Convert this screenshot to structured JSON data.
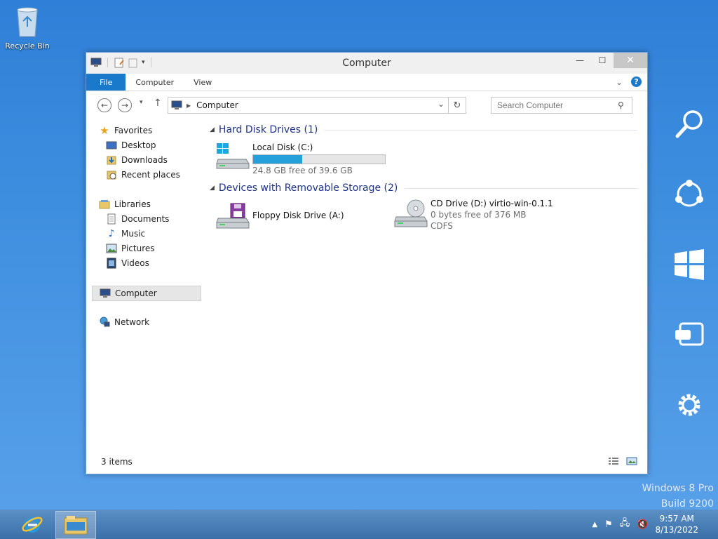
{
  "desktop": {
    "recycle_bin_label": "Recycle Bin"
  },
  "window": {
    "title": "Computer",
    "ribbon": {
      "tabs": [
        "File",
        "Computer",
        "View"
      ]
    },
    "address": {
      "path": "Computer"
    },
    "search": {
      "placeholder": "Search Computer"
    },
    "sidebar": {
      "favorites": "Favorites",
      "favorite_items": [
        "Desktop",
        "Downloads",
        "Recent places"
      ],
      "libraries": "Libraries",
      "library_items": [
        "Documents",
        "Music",
        "Pictures",
        "Videos"
      ],
      "computer": "Computer",
      "network": "Network"
    },
    "groups": [
      {
        "header": "Hard Disk Drives (1)"
      },
      {
        "header": "Devices with Removable Storage (2)"
      }
    ],
    "drives": [
      {
        "name": "Local Disk (C:)",
        "free": "24.8 GB free of 39.6 GB",
        "used_fraction": 0.374
      },
      {
        "name": "Floppy Disk Drive (A:)"
      },
      {
        "name": "CD Drive (D:) virtio-win-0.1.1",
        "free": "0 bytes free of 376 MB",
        "fs": "CDFS"
      }
    ],
    "status": {
      "count": "3 items"
    }
  },
  "system": {
    "version_line1": "Windows 8 Pro",
    "version_line2": "Build 9200",
    "time": "9:57 AM",
    "date": "8/13/2022"
  },
  "colors": {
    "accent": "#1979ca",
    "desktop": "#3f8fe0",
    "bar_fill": "#26a0da"
  }
}
